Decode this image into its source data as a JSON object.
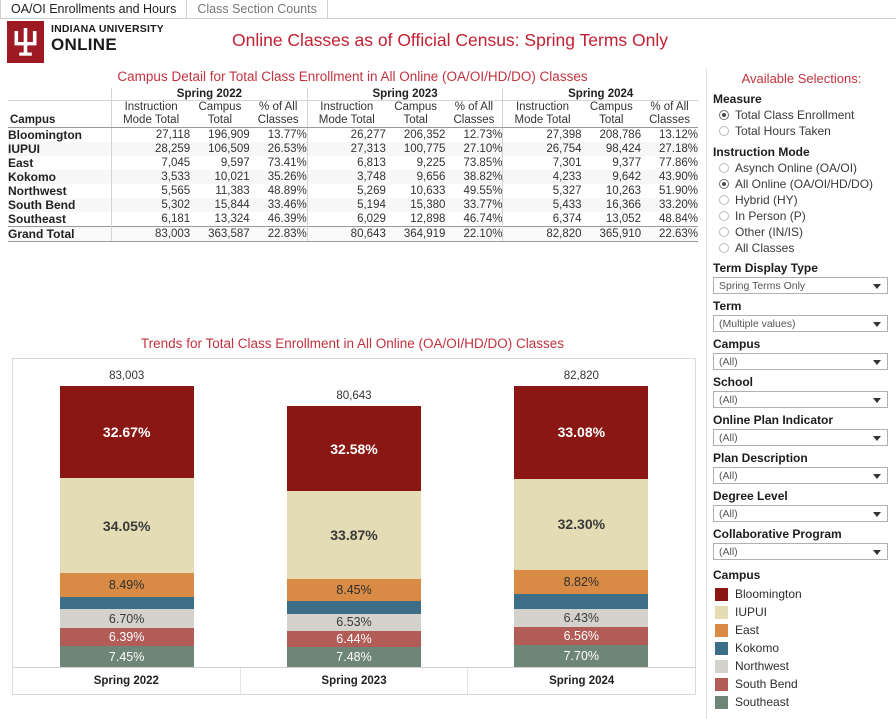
{
  "tabs": [
    {
      "label": "OA/OI Enrollments and Hours",
      "active": true
    },
    {
      "label": "Class Section Counts",
      "active": false
    }
  ],
  "brand": {
    "line1": "INDIANA UNIVERSITY",
    "line2": "ONLINE",
    "logo_icon": "iu-trident-icon",
    "logo_color": "#9d1923"
  },
  "header": {
    "title": "Online Classes as of Official Census: Spring Terms Only",
    "title_color": "#c22032"
  },
  "table": {
    "title": "Campus Detail for Total Class Enrollment in All Online (OA/OI/HD/DO) Classes",
    "corner_header": "Campus",
    "year_groups": [
      "Spring 2022",
      "Spring 2023",
      "Spring 2024"
    ],
    "sub_headers": [
      "Instruction Mode Total",
      "Campus Total",
      "% of All Classes"
    ],
    "sub_headers_lines": [
      [
        "Instruction",
        "Mode Total"
      ],
      [
        "Campus",
        "Total"
      ],
      [
        "% of All",
        "Classes"
      ]
    ],
    "rows": [
      {
        "campus": "Bloomington",
        "cells": [
          "27,118",
          "196,909",
          "13.77%",
          "26,277",
          "206,352",
          "12.73%",
          "27,398",
          "208,786",
          "13.12%"
        ]
      },
      {
        "campus": "IUPUI",
        "cells": [
          "28,259",
          "106,509",
          "26.53%",
          "27,313",
          "100,775",
          "27.10%",
          "26,754",
          "98,424",
          "27.18%"
        ]
      },
      {
        "campus": "East",
        "cells": [
          "7,045",
          "9,597",
          "73.41%",
          "6,813",
          "9,225",
          "73.85%",
          "7,301",
          "9,377",
          "77.86%"
        ]
      },
      {
        "campus": "Kokomo",
        "cells": [
          "3,533",
          "10,021",
          "35.26%",
          "3,748",
          "9,656",
          "38.82%",
          "4,233",
          "9,642",
          "43.90%"
        ]
      },
      {
        "campus": "Northwest",
        "cells": [
          "5,565",
          "11,383",
          "48.89%",
          "5,269",
          "10,633",
          "49.55%",
          "5,327",
          "10,263",
          "51.90%"
        ]
      },
      {
        "campus": "South Bend",
        "cells": [
          "5,302",
          "15,844",
          "33.46%",
          "5,194",
          "15,380",
          "33.77%",
          "5,433",
          "16,366",
          "33.20%"
        ]
      },
      {
        "campus": "Southeast",
        "cells": [
          "6,181",
          "13,324",
          "46.39%",
          "6,029",
          "12,898",
          "46.74%",
          "6,374",
          "13,052",
          "48.84%"
        ]
      }
    ],
    "grand_total": {
      "campus": "Grand Total",
      "cells": [
        "83,003",
        "363,587",
        "22.83%",
        "80,643",
        "364,919",
        "22.10%",
        "82,820",
        "365,910",
        "22.63%"
      ]
    }
  },
  "chart_data": {
    "type": "bar",
    "subtype": "stacked-100-percent",
    "title": "Trends for Total Class Enrollment in All Online (OA/OI/HD/DO) Classes",
    "categories": [
      "Spring 2022",
      "Spring 2023",
      "Spring 2024"
    ],
    "column_totals": [
      "83,003",
      "80,643",
      "82,820"
    ],
    "column_totals_numeric": [
      83003,
      80643,
      82820
    ],
    "xlabel": "",
    "ylabel": "",
    "ylim": [
      0,
      100
    ],
    "grid": false,
    "legend_position": "right",
    "stack_order_bottom_to_top": [
      "Southeast",
      "South Bend",
      "Northwest",
      "Kokomo",
      "East",
      "IUPUI",
      "Bloomington"
    ],
    "series": [
      {
        "name": "Bloomington",
        "color": "#8a1713",
        "values": [
          32.67,
          32.58,
          33.08
        ],
        "labels": [
          "32.67%",
          "32.58%",
          "33.08%"
        ],
        "label_color": "#ffffff"
      },
      {
        "name": "IUPUI",
        "color": "#e3dcb4",
        "values": [
          34.05,
          33.87,
          32.3
        ],
        "labels": [
          "34.05%",
          "33.87%",
          "32.30%"
        ],
        "label_color": "#3a3a3a"
      },
      {
        "name": "East",
        "color": "#d98b45",
        "values": [
          8.49,
          8.45,
          8.82
        ],
        "labels": [
          "8.49%",
          "8.45%",
          "8.82%"
        ],
        "label_color": "#2e2e2e"
      },
      {
        "name": "Kokomo",
        "color": "#3c6e87",
        "values": [
          4.26,
          4.65,
          5.11
        ],
        "labels": [
          "",
          "",
          ""
        ],
        "label_color": "#ffffff"
      },
      {
        "name": "Northwest",
        "color": "#d4d2cd",
        "values": [
          6.7,
          6.53,
          6.43
        ],
        "labels": [
          "6.70%",
          "6.53%",
          "6.43%"
        ],
        "label_color": "#3a3a3a"
      },
      {
        "name": "South Bend",
        "color": "#b25c57",
        "values": [
          6.39,
          6.44,
          6.56
        ],
        "labels": [
          "6.39%",
          "6.44%",
          "6.56%"
        ],
        "label_color": "#ffffff"
      },
      {
        "name": "Southeast",
        "color": "#6e8677",
        "values": [
          7.45,
          7.48,
          7.7
        ],
        "labels": [
          "7.45%",
          "7.48%",
          "7.70%"
        ],
        "label_color": "#ffffff"
      }
    ]
  },
  "panel": {
    "title": "Available Selections:",
    "measure": {
      "label": "Measure",
      "options": [
        {
          "label": "Total Class Enrollment",
          "selected": true
        },
        {
          "label": "Total Hours Taken",
          "selected": false
        }
      ]
    },
    "instruction_mode": {
      "label": "Instruction Mode",
      "options": [
        {
          "label": "Asynch Online (OA/OI)",
          "selected": false
        },
        {
          "label": "All Online (OA/OI/HD/DO)",
          "selected": true
        },
        {
          "label": "Hybrid (HY)",
          "selected": false
        },
        {
          "label": "In Person (P)",
          "selected": false
        },
        {
          "label": "Other (IN/IS)",
          "selected": false
        },
        {
          "label": "All Classes",
          "selected": false
        }
      ]
    },
    "selects": [
      {
        "label": "Term Display Type",
        "value": "Spring Terms Only"
      },
      {
        "label": "Term",
        "value": "(Multiple values)"
      },
      {
        "label": "Campus",
        "value": "(All)"
      },
      {
        "label": "School",
        "value": "(All)"
      },
      {
        "label": "Online Plan Indicator",
        "value": "(All)"
      },
      {
        "label": "Plan Description",
        "value": "(All)"
      },
      {
        "label": "Degree Level",
        "value": "(All)"
      },
      {
        "label": "Collaborative Program",
        "value": "(All)"
      }
    ],
    "legend": {
      "title": "Campus",
      "items": [
        {
          "label": "Bloomington",
          "color": "#8a1713"
        },
        {
          "label": "IUPUI",
          "color": "#e3dcb4"
        },
        {
          "label": "East",
          "color": "#d98b45"
        },
        {
          "label": "Kokomo",
          "color": "#3c6e87"
        },
        {
          "label": "Northwest",
          "color": "#d4d2cd"
        },
        {
          "label": "South Bend",
          "color": "#b25c57"
        },
        {
          "label": "Southeast",
          "color": "#6e8677"
        }
      ]
    }
  }
}
